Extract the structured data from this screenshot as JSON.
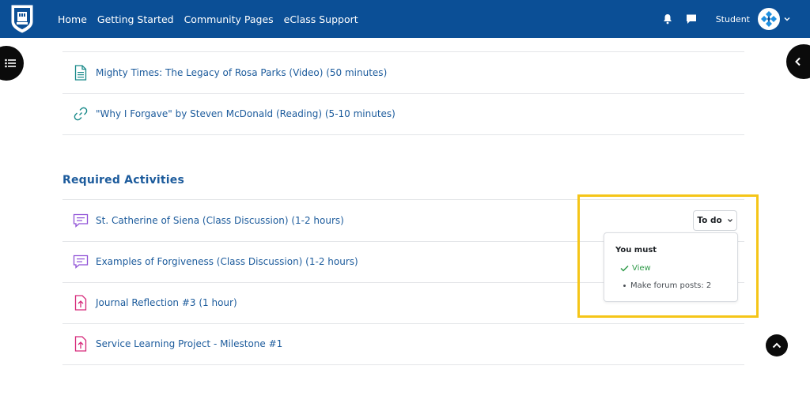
{
  "navbar": {
    "links": [
      "Home",
      "Getting Started",
      "Community Pages",
      "eClass Support"
    ],
    "user_name": "Student",
    "icons": {
      "notifications": "bell-icon",
      "messages": "chat-icon",
      "user_menu": "chevron-down-icon"
    },
    "colors": {
      "background": "#0b4f96",
      "text": "#ffffff"
    }
  },
  "resources": [
    {
      "label": "Mighty Times: The Legacy of Rosa Parks (Video) (50 minutes)",
      "icon": "document-icon"
    },
    {
      "label": "\"Why I Forgave\" by Steven McDonald (Reading) (5-10 minutes)",
      "icon": "link-icon"
    }
  ],
  "section": {
    "title": "Required Activities",
    "activities": [
      {
        "label": "St. Catherine of Siena (Class Discussion) (1-2 hours)",
        "icon": "forum-icon"
      },
      {
        "label": "Examples of Forgiveness (Class Discussion) (1-2 hours)",
        "icon": "forum-icon"
      },
      {
        "label": "Journal Reflection #3 (1 hour)",
        "icon": "assignment-upload-icon"
      },
      {
        "label": "Service Learning Project - Milestone #1",
        "icon": "assignment-upload-icon"
      }
    ]
  },
  "completion": {
    "button_label": "To do",
    "heading": "You must",
    "done_item": "View",
    "pending_item": "Make forum posts: 2"
  },
  "colors": {
    "link": "#1c5b9c",
    "forum_icon": "#8e4fd6",
    "assignment_icon": "#d6297a",
    "resource_icon": "#1a8a8a",
    "done": "#2f9a49",
    "highlight": "#f5c518"
  }
}
